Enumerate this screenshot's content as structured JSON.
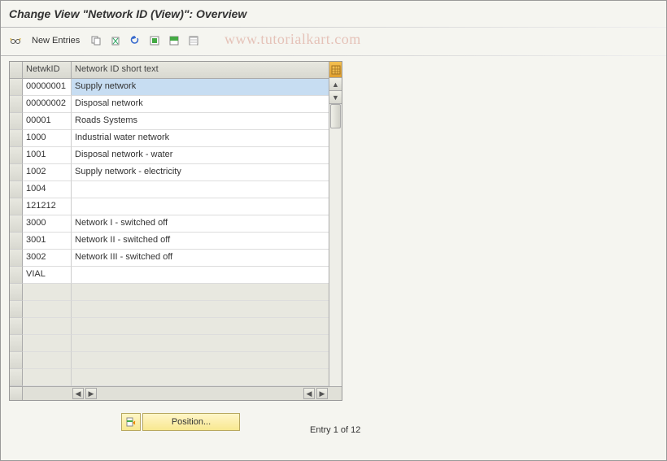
{
  "title": "Change View \"Network ID (View)\": Overview",
  "watermark": "www.tutorialkart.com",
  "toolbar": {
    "new_entries": "New Entries"
  },
  "table": {
    "col_id": "NetwkID",
    "col_text": "Network ID short text",
    "rows": [
      {
        "id": "00000001",
        "text": "Supply network",
        "selected": true
      },
      {
        "id": "00000002",
        "text": "Disposal network"
      },
      {
        "id": "00001",
        "text": "Roads Systems"
      },
      {
        "id": "1000",
        "text": "Industrial water network"
      },
      {
        "id": "1001",
        "text": "Disposal network - water"
      },
      {
        "id": "1002",
        "text": "Supply network - electricity"
      },
      {
        "id": "1004",
        "text": ""
      },
      {
        "id": "121212",
        "text": ""
      },
      {
        "id": "3000",
        "text": "Network I - switched off"
      },
      {
        "id": "3001",
        "text": "Network II - switched off"
      },
      {
        "id": "3002",
        "text": "Network III - switched off"
      },
      {
        "id": "VIAL",
        "text": ""
      }
    ],
    "empty_rows": 6
  },
  "footer": {
    "position_label": "Position...",
    "entry_text": "Entry 1 of 12"
  }
}
